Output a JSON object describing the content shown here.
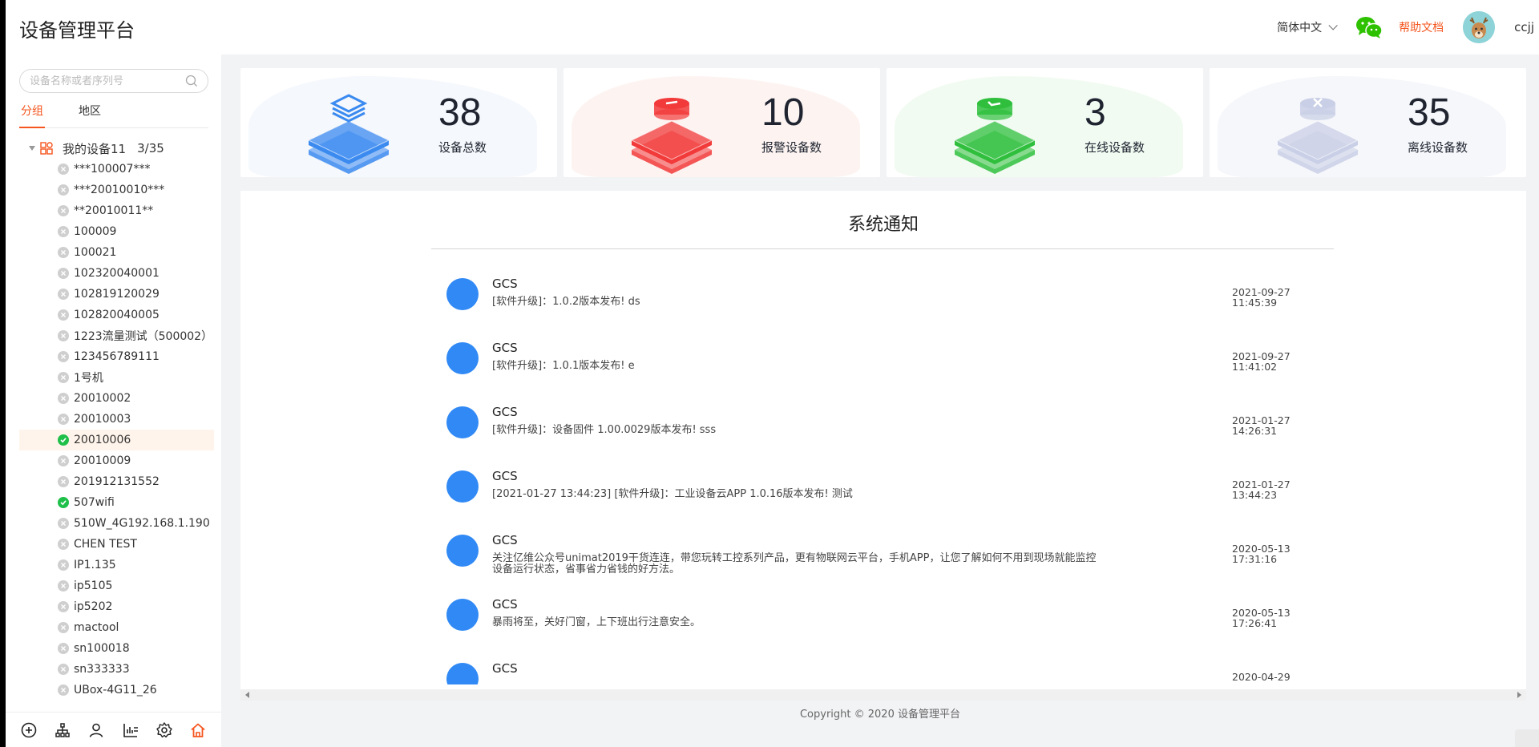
{
  "header": {
    "title": "设备管理平台",
    "language": "简体中文",
    "help_label": "帮助文档",
    "username": "ccjj"
  },
  "sidebar": {
    "search_placeholder": "设备名称或者序列号",
    "tabs": [
      "分组",
      "地区"
    ],
    "active_tab": "分组",
    "root": {
      "label": "我的设备11",
      "count": "3/35"
    },
    "devices": [
      {
        "name": "***100007***",
        "status": "offline"
      },
      {
        "name": "***20010010***",
        "status": "offline"
      },
      {
        "name": "**20010011**",
        "status": "offline"
      },
      {
        "name": "100009",
        "status": "offline"
      },
      {
        "name": "100021",
        "status": "offline"
      },
      {
        "name": "102320040001",
        "status": "offline"
      },
      {
        "name": "102819120029",
        "status": "offline"
      },
      {
        "name": "102820040005",
        "status": "offline"
      },
      {
        "name": "1223流量测试（500002）",
        "status": "offline"
      },
      {
        "name": "123456789111",
        "status": "offline"
      },
      {
        "name": "1号机",
        "status": "offline"
      },
      {
        "name": "20010002",
        "status": "offline"
      },
      {
        "name": "20010003",
        "status": "offline"
      },
      {
        "name": "20010006",
        "status": "online",
        "selected": true
      },
      {
        "name": "20010009",
        "status": "offline"
      },
      {
        "name": "201912131552",
        "status": "offline"
      },
      {
        "name": "507wifi",
        "status": "online"
      },
      {
        "name": "510W_4G192.168.1.190",
        "status": "offline"
      },
      {
        "name": "CHEN TEST",
        "status": "offline"
      },
      {
        "name": "IP1.135",
        "status": "offline"
      },
      {
        "name": "ip5105",
        "status": "offline"
      },
      {
        "name": "ip5202",
        "status": "offline"
      },
      {
        "name": "mactool",
        "status": "offline"
      },
      {
        "name": "sn100018",
        "status": "offline"
      },
      {
        "name": "sn333333",
        "status": "offline"
      },
      {
        "name": "UBox-4G11_26",
        "status": "offline"
      }
    ],
    "bottom_icons": [
      "add-circle-icon",
      "org-tree-icon",
      "user-icon",
      "chart-list-icon",
      "settings-gear-icon",
      "home-icon"
    ]
  },
  "stats": [
    {
      "value": "38",
      "label": "设备总数",
      "color": "#3a8af0",
      "bg": "#f5f8fc"
    },
    {
      "value": "10",
      "label": "报警设备数",
      "color": "#f23a3a",
      "bg": "#fdf4f2"
    },
    {
      "value": "3",
      "label": "在线设备数",
      "color": "#2fbf3d",
      "bg": "#f2fbf2"
    },
    {
      "value": "35",
      "label": "离线设备数",
      "color": "#c9cfe6",
      "bg": "#f6f7fb"
    }
  ],
  "notices_panel": {
    "title": "系统通知",
    "items": [
      {
        "sender": "GCS",
        "message": "[软件升级]：1.0.2版本发布! ds",
        "date": "2021-09-27",
        "time": "11:45:39"
      },
      {
        "sender": "GCS",
        "message": "[软件升级]：1.0.1版本发布! e",
        "date": "2021-09-27",
        "time": "11:41:02"
      },
      {
        "sender": "GCS",
        "message": "[软件升级]：设备固件 1.00.0029版本发布! sss",
        "date": "2021-01-27",
        "time": "14:26:31"
      },
      {
        "sender": "GCS",
        "message": "[2021-01-27 13:44:23] [软件升级]：工业设备云APP 1.0.16版本发布! 测试",
        "date": "2021-01-27",
        "time": "13:44:23"
      },
      {
        "sender": "GCS",
        "message": "关注亿维公众号unimat2019干货连连，带您玩转工控系列产品，更有物联网云平台，手机APP，让您了解如何不用到现场就能监控设备运行状态，省事省力省钱的好方法。",
        "date": "2020-05-13",
        "time": "17:31:16"
      },
      {
        "sender": "GCS",
        "message": "暴雨将至，关好门窗，上下班出行注意安全。",
        "date": "2020-05-13",
        "time": "17:26:41"
      },
      {
        "sender": "GCS",
        "message": "",
        "date": "2020-04-29",
        "time": ""
      }
    ]
  },
  "footer": {
    "copyright": "Copyright © 2020 设备管理平台"
  }
}
